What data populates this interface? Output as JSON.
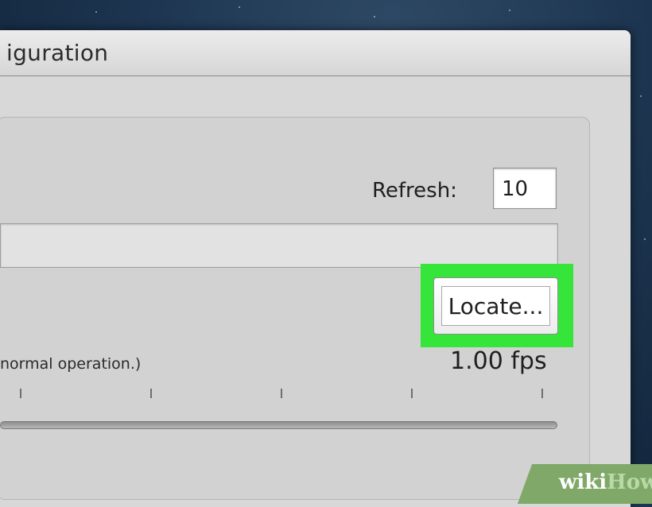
{
  "window": {
    "title": "iguration"
  },
  "refresh": {
    "label": "Refresh:",
    "value": "10"
  },
  "path_field": {
    "value": ""
  },
  "locate": {
    "label": "Locate..."
  },
  "hint": {
    "text": "normal operation.)"
  },
  "fps": {
    "value": "1.00 fps"
  },
  "watermark": {
    "wiki": "wiki",
    "how": "How"
  },
  "colors": {
    "highlight": "#35e53a",
    "window_bg": "#d8d8d8",
    "watermark_bg": "#7fa869"
  }
}
